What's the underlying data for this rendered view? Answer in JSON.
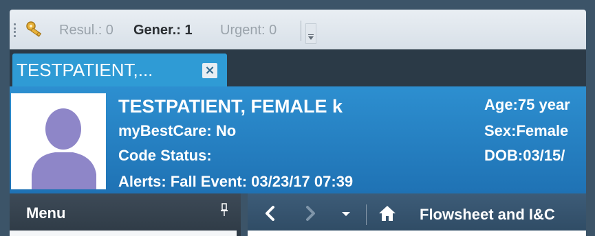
{
  "toolbar": {
    "results_label": "Resul.: 0",
    "general_label": "Gener.: 1",
    "urgent_label": "Urgent: 0",
    "icon": "key-icon"
  },
  "tab": {
    "label": "TESTPATIENT,...",
    "close": "×"
  },
  "banner": {
    "name": "TESTPATIENT, FEMALE k",
    "my_best_care": "myBestCare: No",
    "code_status": "Code Status:",
    "alerts": "Alerts: Fall Event: 03/23/17 07:39",
    "age": "Age:75 year",
    "sex": "Sex:Female",
    "dob": "DOB:03/15/"
  },
  "menu": {
    "title": "Menu",
    "pin_icon": "pin-icon"
  },
  "nav": {
    "title": "Flowsheet and I&C",
    "back_icon": "back-arrow-icon",
    "forward_icon": "forward-arrow-icon",
    "dropdown_icon": "dropdown-arrow-icon",
    "home_icon": "home-icon"
  },
  "colors": {
    "banner_blue": "#2d8fd0",
    "tab_blue": "#2f9bd5",
    "dark_bar": "#2e3a45"
  }
}
